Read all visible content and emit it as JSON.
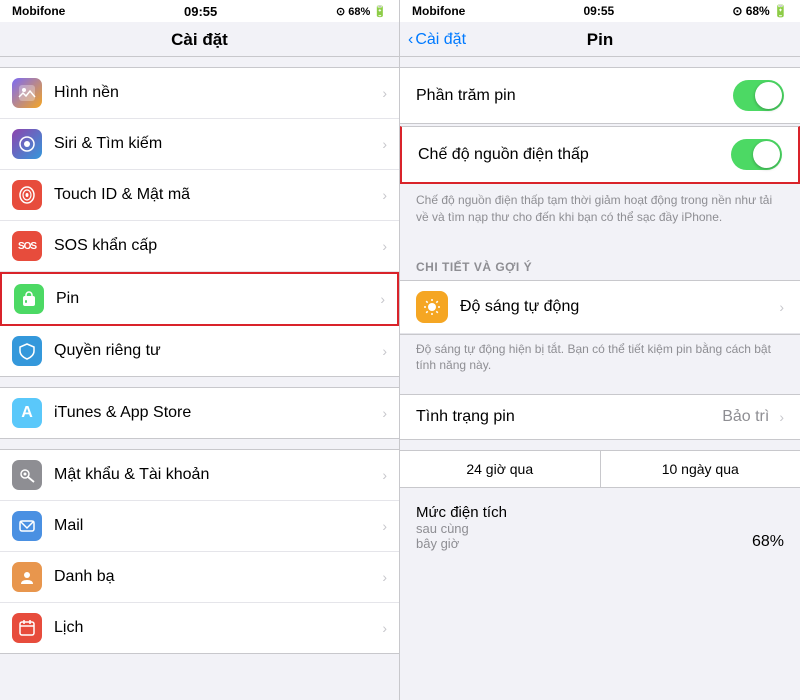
{
  "left": {
    "carrier": "Mobifone",
    "time": "09:55",
    "status_icons": "⊕ 68%",
    "title": "Cài đặt",
    "items": [
      {
        "id": "wallpaper",
        "label": "Hình nền",
        "icon_class": "ic-wallpaper",
        "icon": "🖼",
        "highlighted": false
      },
      {
        "id": "siri",
        "label": "Siri & Tìm kiếm",
        "icon_class": "ic-siri",
        "icon": "✦",
        "highlighted": false
      },
      {
        "id": "touchid",
        "label": "Touch ID & Mật mã",
        "icon_class": "ic-touchid",
        "icon": "◉",
        "highlighted": false
      },
      {
        "id": "sos",
        "label": "SOS khẩn cấp",
        "icon_class": "ic-sos",
        "icon": "SOS",
        "highlighted": false
      },
      {
        "id": "pin",
        "label": "Pin",
        "icon_class": "ic-pin",
        "icon": "🔋",
        "highlighted": true
      },
      {
        "id": "privacy",
        "label": "Quyền riêng tư",
        "icon_class": "ic-privacy",
        "icon": "✋",
        "highlighted": false
      },
      {
        "id": "itunes",
        "label": "iTunes & App Store",
        "icon_class": "ic-itunes",
        "icon": "A",
        "highlighted": false
      },
      {
        "id": "password",
        "label": "Mật khẩu & Tài khoản",
        "icon_class": "ic-password",
        "icon": "🔑",
        "highlighted": false
      },
      {
        "id": "mail",
        "label": "Mail",
        "icon_class": "ic-mail",
        "icon": "✉",
        "highlighted": false
      },
      {
        "id": "contacts",
        "label": "Danh bạ",
        "icon_class": "ic-contacts",
        "icon": "📇",
        "highlighted": false
      },
      {
        "id": "calendar",
        "label": "Lịch",
        "icon_class": "ic-calendar",
        "icon": "📅",
        "highlighted": false
      }
    ]
  },
  "right": {
    "carrier": "Mobifone",
    "time": "09:55",
    "status_icons": "⊕ 68%",
    "back_label": "Cài đặt",
    "title": "Pin",
    "phan_tram_pin": "Phần trăm pin",
    "che_do_nguon": "Chế độ nguồn điện thấp",
    "che_do_desc": "Chế độ nguồn điện thấp tạm thời giảm hoạt động trong nền như tải về và tìm nạp thư cho đến khi bạn có thể sạc đầy iPhone.",
    "chi_tiet_label": "CHI TIẾT VÀ GỢI Ý",
    "do_sang": "Độ sáng tự động",
    "do_sang_desc": "Độ sáng tự động hiện bị tắt. Bạn có thể tiết kiệm pin bằng cách bật tính năng này.",
    "tinh_trang": "Tình trạng pin",
    "bao_tri": "Bảo trì",
    "tab1": "24 giờ qua",
    "tab2": "10 ngày qua",
    "muc_label": "Mức điện tích",
    "muc_sub": "sau cùng",
    "muc_sub2": "bây giờ",
    "muc_value": "68%"
  }
}
